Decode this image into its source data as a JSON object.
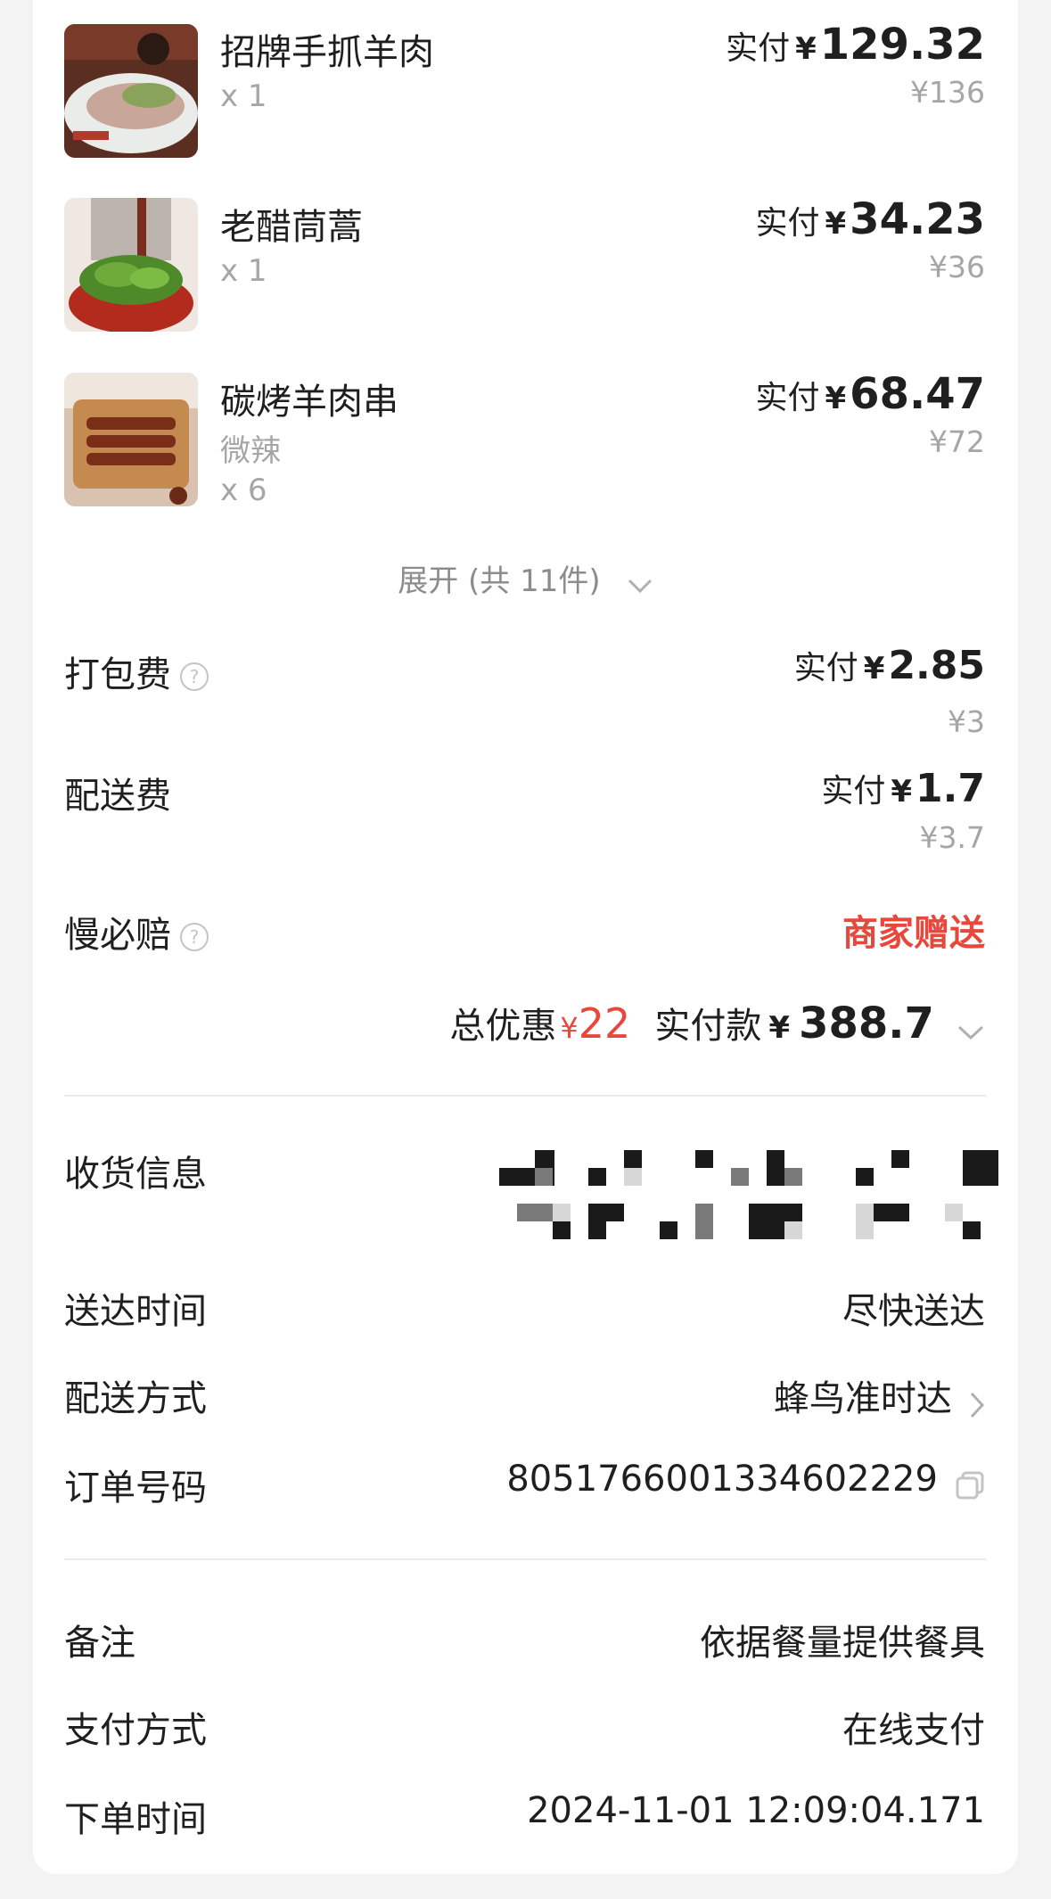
{
  "items": [
    {
      "name": "招牌手抓羊肉",
      "spec": "",
      "qty": "x 1",
      "pay_label": "实付",
      "currency": "¥",
      "pay": "129.32",
      "original": "¥136"
    },
    {
      "name": "老醋茼蒿",
      "spec": "",
      "qty": "x 1",
      "pay_label": "实付",
      "currency": "¥",
      "pay": "34.23",
      "original": "¥36"
    },
    {
      "name": "碳烤羊肉串",
      "spec": "微辣",
      "qty": "x 6",
      "pay_label": "实付",
      "currency": "¥",
      "pay": "68.47",
      "original": "¥72"
    }
  ],
  "expand": {
    "label": "展开 (共 11件)"
  },
  "fees": {
    "packing": {
      "label": "打包费",
      "pay_label": "实付",
      "currency": "¥",
      "pay": "2.85",
      "original": "¥3"
    },
    "delivery": {
      "label": "配送费",
      "pay_label": "实付",
      "currency": "¥",
      "pay": "1.7",
      "original": "¥3.7"
    },
    "late_comp": {
      "label": "慢必赔",
      "value": "商家赠送"
    }
  },
  "summary": {
    "discount_label": "总优惠",
    "discount_currency": "¥",
    "discount_value": "22",
    "paid_label": "实付款",
    "paid_currency": "¥",
    "paid_value": "388.7"
  },
  "info": {
    "address_label": "收货信息",
    "arrival_label": "送达时间",
    "arrival_value": "尽快送达",
    "method_label": "配送方式",
    "method_value": "蜂鸟准时达",
    "order_label": "订单号码",
    "order_value": "8051766001334602229",
    "note_label": "备注",
    "note_value": "依据餐量提供餐具",
    "payment_label": "支付方式",
    "payment_value": "在线支付",
    "time_label": "下单时间",
    "time_value": "2024-11-01 12:09:04.171"
  },
  "colors": {
    "accent_red": "#e8473b",
    "muted": "#a6a6a6",
    "divider": "#ebebeb"
  },
  "icons": [
    "question-mark-icon",
    "chevron-down-icon",
    "chevron-right-icon",
    "copy-icon"
  ]
}
